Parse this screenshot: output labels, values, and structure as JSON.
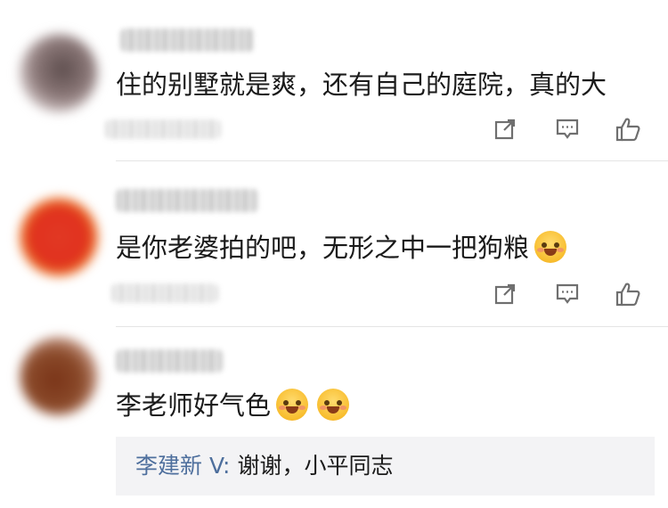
{
  "comments": [
    {
      "text": "住的别墅就是爽，还有自己的庭院，真的大",
      "emoji_count": 0,
      "avatar_color": "#7a6a68",
      "icons": [
        "share-icon",
        "comment-icon",
        "like-icon"
      ]
    },
    {
      "text": "是你老婆拍的吧，无形之中一把狗粮",
      "emoji_count": 1,
      "avatar_color": "#e0301e",
      "icons": [
        "share-icon",
        "comment-icon",
        "like-icon"
      ]
    },
    {
      "text": "李老师好气色",
      "emoji_count": 2,
      "avatar_color": "#8a4a2a",
      "reply": {
        "name": "李建新",
        "verified": "V",
        "text": "谢谢，小平同志"
      }
    }
  ],
  "colors": {
    "reply_name": "#4e6f9d",
    "reply_bg": "#f3f3f5",
    "icon": "#6f6f6f"
  }
}
